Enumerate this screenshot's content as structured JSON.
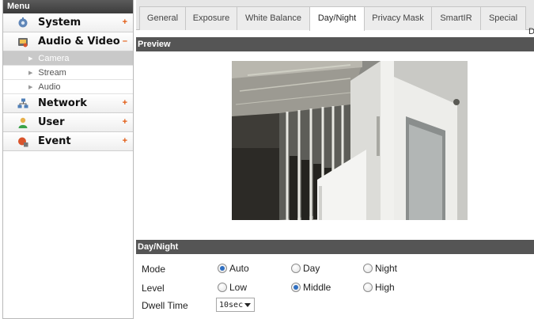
{
  "sidebar": {
    "title": "Menu",
    "items": [
      {
        "label": "System",
        "indicator": "+",
        "icon": "system-icon"
      },
      {
        "label": "Audio & Video",
        "indicator": "–",
        "icon": "audio-video-icon",
        "children": [
          {
            "label": "Camera",
            "active": true
          },
          {
            "label": "Stream",
            "active": false
          },
          {
            "label": "Audio",
            "active": false
          }
        ]
      },
      {
        "label": "Network",
        "indicator": "+",
        "icon": "network-icon"
      },
      {
        "label": "User",
        "indicator": "+",
        "icon": "user-icon"
      },
      {
        "label": "Event",
        "indicator": "+",
        "icon": "event-icon"
      }
    ]
  },
  "tabs": [
    {
      "label": "General",
      "active": false
    },
    {
      "label": "Exposure",
      "active": false
    },
    {
      "label": "White Balance",
      "active": false
    },
    {
      "label": "Day/Night",
      "active": true
    },
    {
      "label": "Privacy Mask",
      "active": false
    },
    {
      "label": "SmartIR",
      "active": false
    },
    {
      "label": "Special",
      "active": false
    }
  ],
  "tab_overflow_text": "D",
  "preview": {
    "title": "Preview"
  },
  "day_night": {
    "title": "Day/Night",
    "mode": {
      "label": "Mode",
      "options": [
        "Auto",
        "Day",
        "Night"
      ],
      "selected": "Auto"
    },
    "level": {
      "label": "Level",
      "options": [
        "Low",
        "Middle",
        "High"
      ],
      "selected": "Middle"
    },
    "dwell_time": {
      "label": "Dwell Time",
      "value": "10sec"
    }
  },
  "colors": {
    "accent": "#e25a12",
    "section_bar": "#555555",
    "active_sub": "#c9c9c9",
    "radio_on": "#2f6fc1"
  }
}
